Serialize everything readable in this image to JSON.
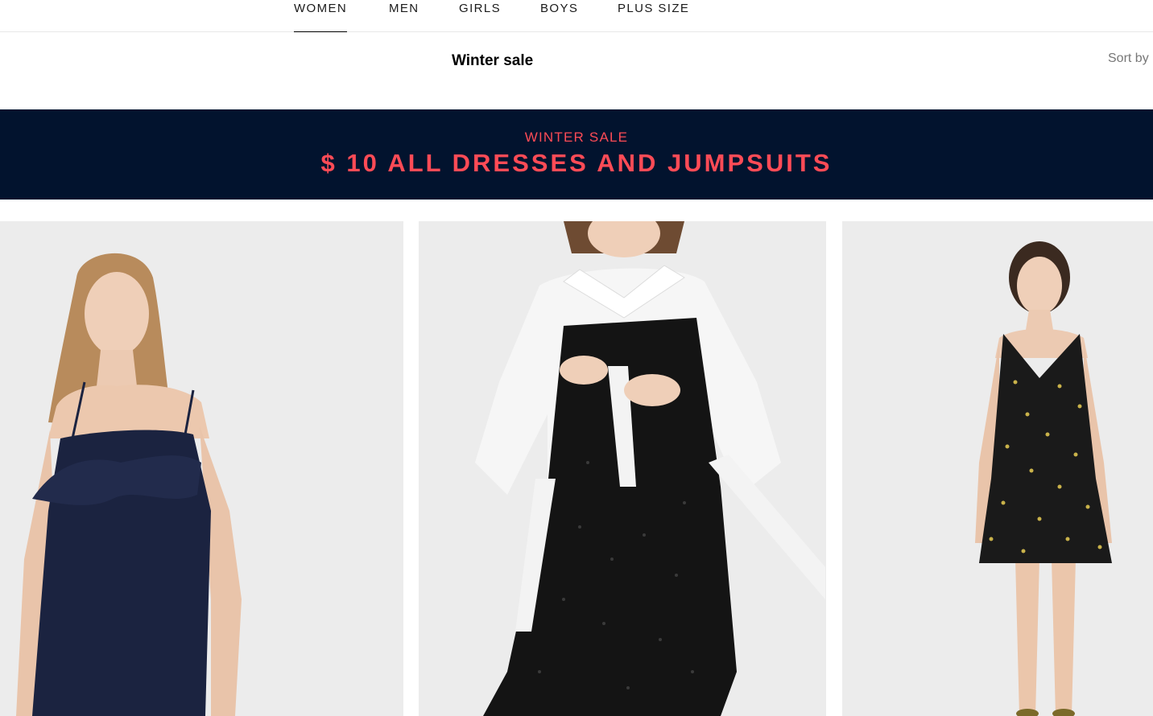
{
  "nav": {
    "tabs": [
      {
        "label": "WOMEN",
        "active": true
      },
      {
        "label": "MEN",
        "active": false
      },
      {
        "label": "GIRLS",
        "active": false
      },
      {
        "label": "BOYS",
        "active": false
      },
      {
        "label": "PLUS SIZE",
        "active": false
      }
    ]
  },
  "header": {
    "title": "Winter sale",
    "sort_label": "Sort by"
  },
  "banner": {
    "kicker": "WINTER SALE",
    "headline": "$ 10 ALL DRESSES AND JUMPSUITS",
    "text_color": "#ff4b56",
    "background": "#02132e"
  },
  "products": [
    {
      "image": "navy-ruffle-slip-dress-photo",
      "dress_color": "#1b2340"
    },
    {
      "image": "black-sequin-slip-dress-over-white-shirt-photo",
      "dress_color": "#141414"
    },
    {
      "image": "black-polka-dot-shift-dress-photo",
      "dress_color": "#1a1a1a"
    }
  ]
}
